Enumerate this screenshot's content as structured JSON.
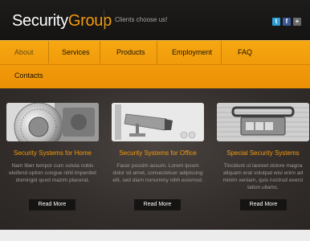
{
  "header": {
    "logo_white": "Security",
    "logo_orange": "Group",
    "slogan": "Clients choose us!",
    "social": [
      {
        "icon": "twitter-icon",
        "glyph": "t"
      },
      {
        "icon": "facebook-icon",
        "glyph": "f"
      },
      {
        "icon": "google-plus-icon",
        "glyph": "+"
      }
    ]
  },
  "nav": {
    "items": [
      "About",
      "Services",
      "Products",
      "Employment",
      "FAQ",
      "Contacts"
    ],
    "active": "About"
  },
  "cards": [
    {
      "title": "Security Systems for Home",
      "text": "Nam liber tempor cum soluta nobis eleifend option congue nihil imperdiet domingid quod mazim placerat.",
      "button": "Read More",
      "image": "safe-dial-image"
    },
    {
      "title": "Security Systems for Office",
      "text": "Facer possim assum. Lorem ipsum dolor sit amet, consectetuer adipiscing elit, sed diam nonummy nibh euismod.",
      "button": "Read More",
      "image": "security-camera-image"
    },
    {
      "title": "Special Security Systems",
      "text": "Tincidunt ut laoreet dolore magna aliquam erat volutpat wisi enim ad minim veniam, quis nostrud exerci tation ullamc.",
      "button": "Read More",
      "image": "briefcase-lock-image"
    }
  ],
  "colors": {
    "accent": "#f39a0c",
    "header_bg": "#1a1918",
    "nav_bg": "#f29c0d",
    "content_bg": "#3a3432",
    "button_bg": "#161412"
  }
}
